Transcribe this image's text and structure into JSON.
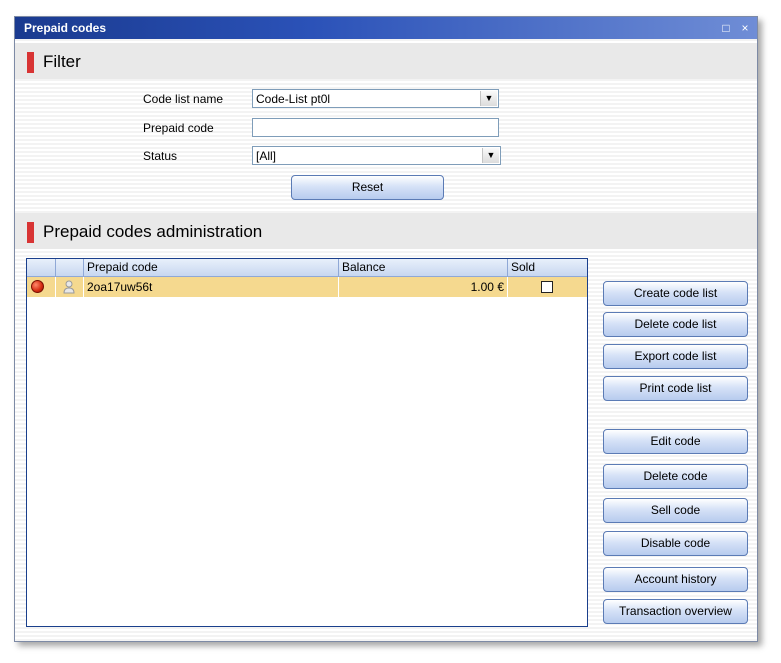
{
  "window": {
    "title": "Prepaid codes",
    "restore_glyph": "□",
    "close_glyph": "×"
  },
  "filter": {
    "header": "Filter",
    "code_list_label": "Code list name",
    "code_list_value": "Code-List pt0l",
    "prepaid_code_label": "Prepaid code",
    "prepaid_code_value": "",
    "status_label": "Status",
    "status_value": "[All]",
    "dropdown_glyph": "▼",
    "reset_label": "Reset"
  },
  "admin": {
    "header": "Prepaid codes administration",
    "columns": [
      "",
      "",
      "Prepaid code",
      "Balance",
      "Sold"
    ],
    "rows": [
      {
        "code": "2oa17uw56t",
        "balance": "1.00 €",
        "sold": false,
        "status_icon": "red-status-icon",
        "user_icon": "user-icon"
      }
    ]
  },
  "buttons": {
    "create_code_list": "Create code list",
    "delete_code_list": "Delete code list",
    "export_code_list": "Export code list",
    "print_code_list": "Print code list",
    "edit_code": "Edit code",
    "delete_code": "Delete code",
    "sell_code": "Sell code",
    "disable_code": "Disable code",
    "account_history": "Account history",
    "transaction_overview": "Transaction overview"
  },
  "colors": {
    "titlebar": "#2b52b8",
    "accent_bar": "#d83434",
    "selected_row": "#f5d98f"
  }
}
